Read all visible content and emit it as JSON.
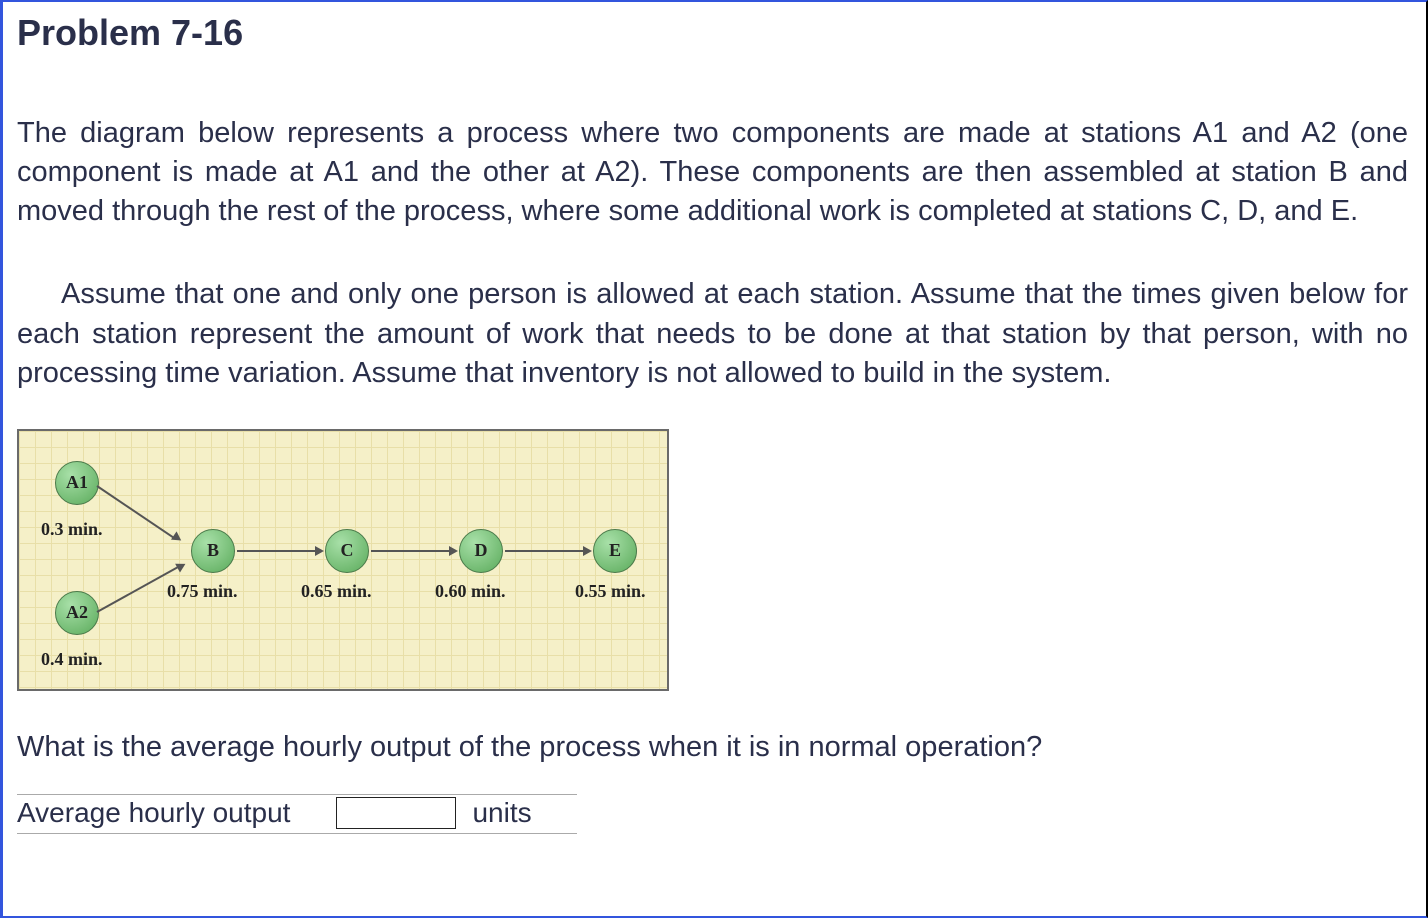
{
  "title": "Problem 7-16",
  "paragraph1": "The diagram below represents a process where two components are made at stations A1 and A2 (one component is made at A1 and the other at A2). These components are then assembled at station B and moved through the rest of the process, where some additional work is completed at stations C, D, and E.",
  "paragraph2": "Assume that one and only one person is allowed at each station. Assume that the times given below for each station represent the amount of work that needs to be done at that station by that person, with no processing time variation. Assume that inventory is not allowed to build in the system.",
  "diagram": {
    "nodes": {
      "a1": {
        "label": "A1",
        "time": "0.3 min."
      },
      "a2": {
        "label": "A2",
        "time": "0.4 min."
      },
      "b": {
        "label": "B",
        "time": "0.75 min."
      },
      "c": {
        "label": "C",
        "time": "0.65 min."
      },
      "d": {
        "label": "D",
        "time": "0.60 min."
      },
      "e": {
        "label": "E",
        "time": "0.55 min."
      }
    }
  },
  "question": "What is the average hourly output of the process when it is in normal operation?",
  "answer_label": "Average hourly output",
  "answer_units": "units"
}
